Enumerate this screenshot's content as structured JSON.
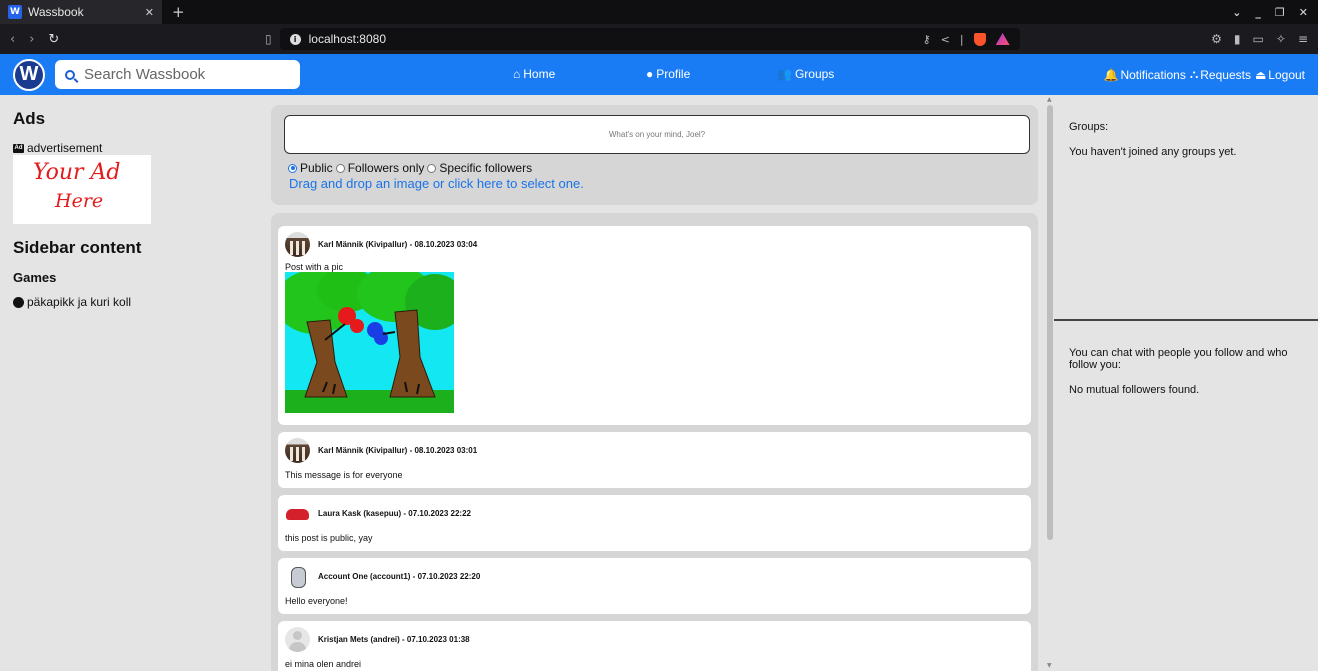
{
  "browser": {
    "tab_title": "Wassbook",
    "tab_favicon": "W",
    "url": "localhost:8080"
  },
  "navbar": {
    "logo_letter": "W",
    "search_placeholder": "Search Wassbook",
    "home": "Home",
    "profile": "Profile",
    "groups": "Groups",
    "notifications": "Notifications",
    "requests": "Requests",
    "logout": "Logout",
    "accent_color": "#1a7cf5"
  },
  "left_sidebar": {
    "ads_title": "Ads",
    "ad_label": "advertisement",
    "ad_text_line1": "Your Ad",
    "ad_text_line2": "Here",
    "sidebar_title": "Sidebar content",
    "games_title": "Games",
    "game_item": "päkapikk ja kuri koll"
  },
  "compose": {
    "placeholder": "What's on your mind, Joel?",
    "privacy_options": [
      "Public",
      "Followers only",
      "Specific followers"
    ],
    "selected_privacy": "Public",
    "dropzone_text": "Drag and drop an image or click here to select one."
  },
  "posts": [
    {
      "author": "Karl Männik (Kivipallur) - 08.10.2023 03:04",
      "text": "Post with a pic",
      "has_image": true
    },
    {
      "author": "Karl Männik (Kivipallur) - 08.10.2023 03:01",
      "text": "This message is for everyone"
    },
    {
      "author": "Laura Kask (kasepuu) - 07.10.2023 22:22",
      "text": "this post is public, yay"
    },
    {
      "author": "Account One (account1) - 07.10.2023 22:20",
      "text": "Hello everyone!"
    },
    {
      "author": "Kristjan Mets (andrei) - 07.10.2023 01:38",
      "text": "ei mina olen andrei"
    }
  ],
  "right_sidebar": {
    "groups_label": "Groups:",
    "groups_empty": "You haven't joined any groups yet.",
    "chat_info": "You can chat with people you follow and who follow you:",
    "chat_empty": "No mutual followers found."
  }
}
